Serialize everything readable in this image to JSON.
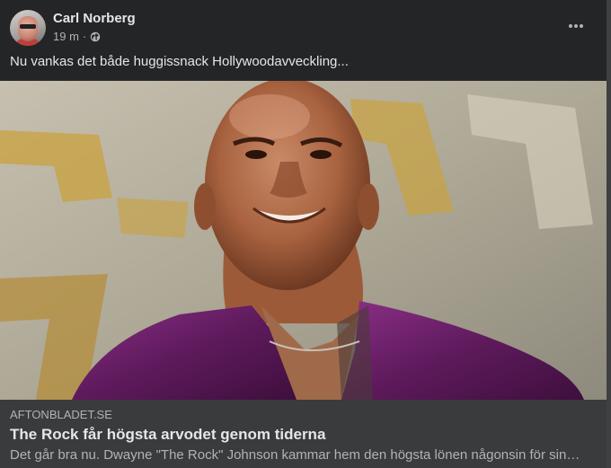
{
  "post": {
    "author": "Carl Norberg",
    "time": "19 m",
    "separator": "·",
    "privacy_icon": "globe-icon",
    "more_icon": "more-options-icon",
    "text": "Nu vankas det både huggissnack Hollywoodavveckling..."
  },
  "link": {
    "domain": "AFTONBLADET.SE",
    "title": "The Rock får högsta arvodet genom tiderna",
    "description": "Det går bra nu. Dwayne \"The Rock\" Johnson kammar hem den högsta lönen någonsin för sin…"
  },
  "colors": {
    "card_bg": "#242526",
    "link_box_bg": "#3a3b3c",
    "primary_text": "#e4e6eb",
    "secondary_text": "#b0b3b8"
  }
}
